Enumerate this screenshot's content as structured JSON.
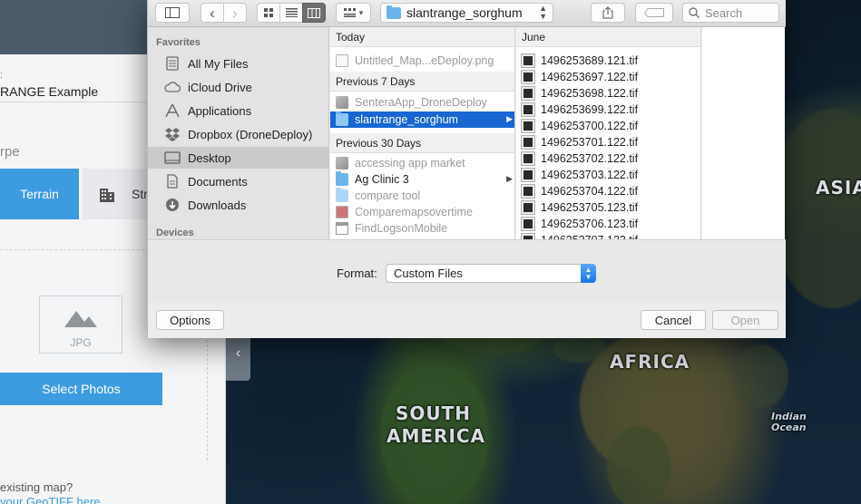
{
  "app": {
    "project_name": "RANGE Example",
    "type_label": "rpe",
    "terrain_label": "Terrain",
    "structure_label": "Str",
    "jpg_label": "JPG",
    "select_photos_label": "Select Photos",
    "existing_map_text": " existing map?",
    "geotiff_link_text": "your GeoTIFF here",
    "accent_color": "#3d9be0"
  },
  "map": {
    "labels": [
      "ASIA",
      "AFRICA",
      "SOUTH",
      "AMERICA"
    ],
    "ocean_labels": [
      "Indian",
      "Ocean"
    ],
    "collapse_icon": "chevron-left-icon"
  },
  "dialog": {
    "toolbar": {
      "location": "slantrange_sorghum",
      "search_placeholder": "Search",
      "view_mode": "columns"
    },
    "sidebar": {
      "favorites_heading": "Favorites",
      "devices_heading": "Devices",
      "items": [
        {
          "label": "All My Files",
          "icon": "all-files-icon"
        },
        {
          "label": "iCloud Drive",
          "icon": "cloud-icon"
        },
        {
          "label": "Applications",
          "icon": "applications-icon"
        },
        {
          "label": "Dropbox (DroneDeploy)",
          "icon": "dropbox-icon"
        },
        {
          "label": "Desktop",
          "icon": "desktop-icon",
          "active": true
        },
        {
          "label": "Documents",
          "icon": "documents-icon"
        },
        {
          "label": "Downloads",
          "icon": "downloads-icon"
        }
      ]
    },
    "column1": {
      "groups": [
        {
          "heading": "Today",
          "rows": [
            {
              "name": "Untitled_Map...eDeploy.png",
              "icon": "doc",
              "enabled": false
            }
          ]
        },
        {
          "heading": "Previous 7 Days",
          "rows": [
            {
              "name": "SenteraApp_DroneDeploy",
              "icon": "app",
              "enabled": false
            },
            {
              "name": "slantrange_sorghum",
              "icon": "folder",
              "enabled": true,
              "selected": true,
              "has_children": true
            }
          ]
        },
        {
          "heading": "Previous 30 Days",
          "rows": [
            {
              "name": "accessing app market",
              "icon": "app",
              "enabled": false
            },
            {
              "name": "Ag Clinic 3",
              "icon": "folder",
              "enabled": true,
              "has_children": true
            },
            {
              "name": "compare tool",
              "icon": "folder",
              "enabled": false
            },
            {
              "name": "Comparemapsovertime",
              "icon": "red",
              "enabled": false
            },
            {
              "name": "FindLogsonMobile",
              "icon": "win",
              "enabled": false
            }
          ]
        }
      ]
    },
    "column2": {
      "heading": "June",
      "rows": [
        "1496253689.121.tif",
        "1496253697.122.tif",
        "1496253698.122.tif",
        "1496253699.122.tif",
        "1496253700.122.tif",
        "1496253701.122.tif",
        "1496253702.122.tif",
        "1496253703.122.tif",
        "1496253704.122.tif",
        "1496253705.123.tif",
        "1496253706.123.tif",
        "1496253707.123.tif"
      ]
    },
    "format": {
      "label": "Format:",
      "value": "Custom Files"
    },
    "buttons": {
      "options": "Options",
      "cancel": "Cancel",
      "open": "Open"
    }
  }
}
